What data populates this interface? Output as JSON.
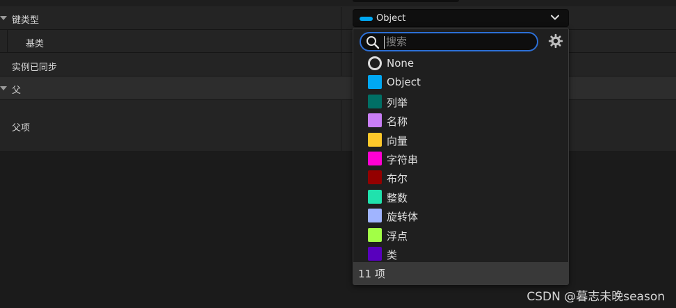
{
  "properties": {
    "key_type_label": "键类型",
    "base_class_label": "基类",
    "replicated_label": "实例已同步",
    "parent_category_label": "父",
    "parent_item_label": "父项"
  },
  "combo": {
    "selected": "Object",
    "selected_color": "#00a8f3"
  },
  "popup": {
    "search_placeholder": "搜索",
    "items": [
      {
        "label": "None",
        "icon": "none-ring-icon"
      },
      {
        "label": "Object",
        "color": "#00a8f3"
      },
      {
        "label": "列举",
        "color": "#006f65"
      },
      {
        "label": "名称",
        "color": "#c97ef5"
      },
      {
        "label": "向量",
        "color": "#fdc82a"
      },
      {
        "label": "字符串",
        "color": "#ff00d4"
      },
      {
        "label": "布尔",
        "color": "#940000"
      },
      {
        "label": "整数",
        "color": "#20e2ad"
      },
      {
        "label": "旋转体",
        "color": "#a0b4ff"
      },
      {
        "label": "浮点",
        "color": "#a2ff46"
      },
      {
        "label": "类",
        "color": "#5800bd"
      }
    ],
    "count_text": "11 项"
  },
  "watermark": "CSDN @暮志未晚season"
}
